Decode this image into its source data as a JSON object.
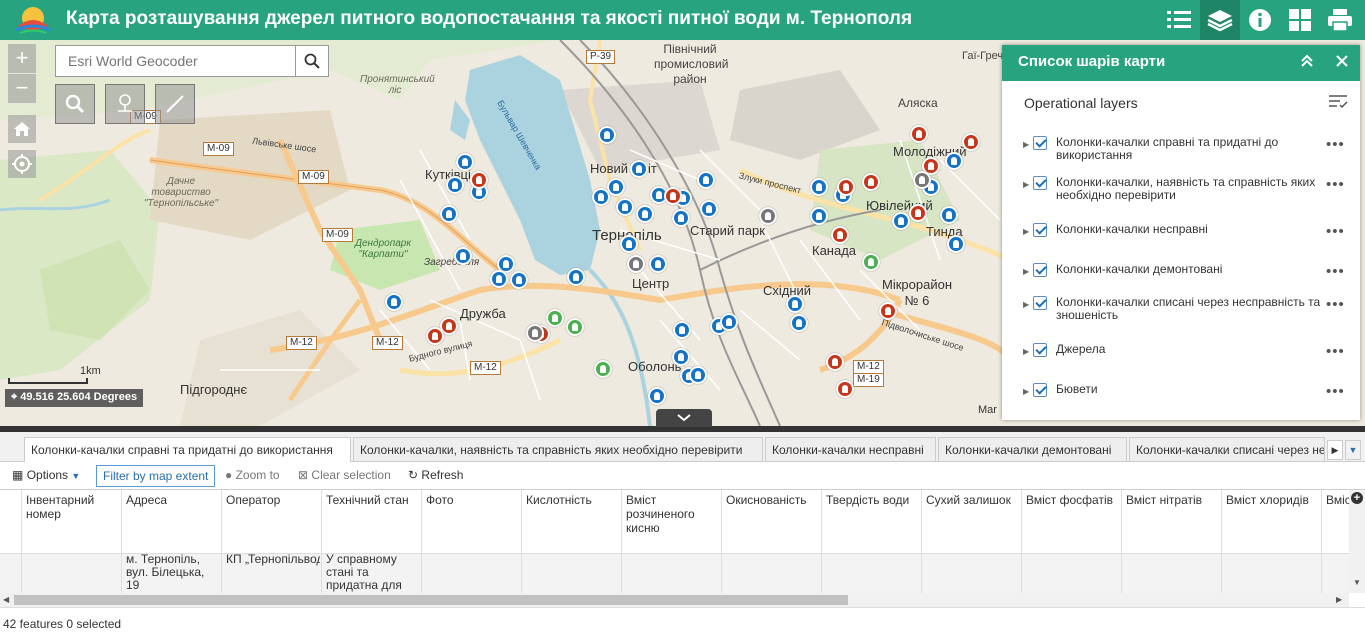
{
  "header": {
    "title": "Карта розташування джерел питного водопостачання та якості питної води м. Тернополя",
    "accent_color": "#27a47f",
    "buttons": [
      "legend-icon",
      "layers-icon",
      "info-icon",
      "basemap-gallery-icon",
      "print-icon"
    ]
  },
  "map": {
    "search": {
      "placeholder": "Esri World Geocoder"
    },
    "zoom_in": "+",
    "zoom_out": "−",
    "scale_label": "1km",
    "coordinates": "49.516 25.604 Degrees",
    "attribution": "Mar",
    "labels": {
      "pivnichnyi": "Північний промисловий район",
      "aliaska": "Аляска",
      "molodizhnyi": "Молодіжний",
      "yuvileinyi": "Ювілейний",
      "tynda": "Тинда",
      "kanada": "Канада",
      "mikroraion": "Мікрорайон № 6",
      "skhidnyi": "Східний",
      "staryi_park": "Старий парк",
      "ternopil": "Тернопіль",
      "tsentr": "Центр",
      "novyi_svit": "Новий Світ",
      "kutkivtsi": "Кутківці",
      "druzhba": "Дружба",
      "obolon": "Оболонь",
      "pidhorodne": "Підгороднє",
      "zahrebellia": "Загребелля",
      "hai_shevchenkivski": "Гаї-Гречин",
      "dachne": "Дачне товариство \"Тернопільське\"",
      "dendropark": "Дендропарк \"Карпати\"",
      "pronyatynskyi": "Пронятинський ліс",
      "budnoho": "Будного вулиця",
      "lvivske": "Львівське шосе",
      "zluky": "Злуки проспект",
      "pidvolochyske": "Підволочиське шосе",
      "bulvar": "Бульвар Шевченка"
    },
    "road_shields": [
      "M-09",
      "M-09",
      "M-09",
      "M-09",
      "M-12",
      "M-12",
      "M-12",
      "M-12",
      "M-19",
      "P-39"
    ]
  },
  "layer_list": {
    "title": "Список шарів карти",
    "operational_label": "Operational layers",
    "layers": [
      {
        "label": "Колонки-качалки справні та придатні до використання",
        "checked": true
      },
      {
        "label": "Колонки-качалки, наявність та справність яких необхідно перевірити",
        "checked": true
      },
      {
        "label": "Колонки-качалки несправні",
        "checked": true
      },
      {
        "label": "Колонки-качалки демонтовані",
        "checked": true
      },
      {
        "label": "Колонки-качалки списані через несправність та зношеність",
        "checked": true
      },
      {
        "label": "Джерела",
        "checked": true
      },
      {
        "label": "Бювети",
        "checked": true
      }
    ]
  },
  "attribute_table": {
    "tabs": [
      "Колонки-качалки справні та придатні до використання",
      "Колонки-качалки, наявність та справність яких необхідно перевірити",
      "Колонки-качалки несправні",
      "Колонки-качалки демонтовані",
      "Колонки-качалки списані через несправність та зношеність"
    ],
    "toolbar": {
      "options": "Options",
      "filter": "Filter by map extent",
      "zoom_to": "Zoom to",
      "clear_selection": "Clear selection",
      "refresh": "Refresh"
    },
    "columns": [
      "Інвентарний номер",
      "Адреса",
      "Оператор",
      "Технічний стан",
      "Фото",
      "Кислотність",
      "Вміст розчиненого кисню",
      "Окиснованість",
      "Твердість води",
      "Сухий залишок",
      "Вміст фосфатів",
      "Вміст нітратів",
      "Вміст хлоридів",
      "Вміст"
    ],
    "row": {
      "address": "м. Тернопіль, вул. Білецька, 19",
      "operator": "КП „Тернопільводоканал“",
      "state": "У справному стані та придатна для використання"
    },
    "footer": "42 features 0 selected"
  },
  "colors": {
    "marker_blue": "#1473c6",
    "marker_red": "#c8361a",
    "marker_grey": "#777777",
    "marker_green": "#4caf50",
    "water": "#aad3df",
    "park": "#c8e6b0"
  }
}
